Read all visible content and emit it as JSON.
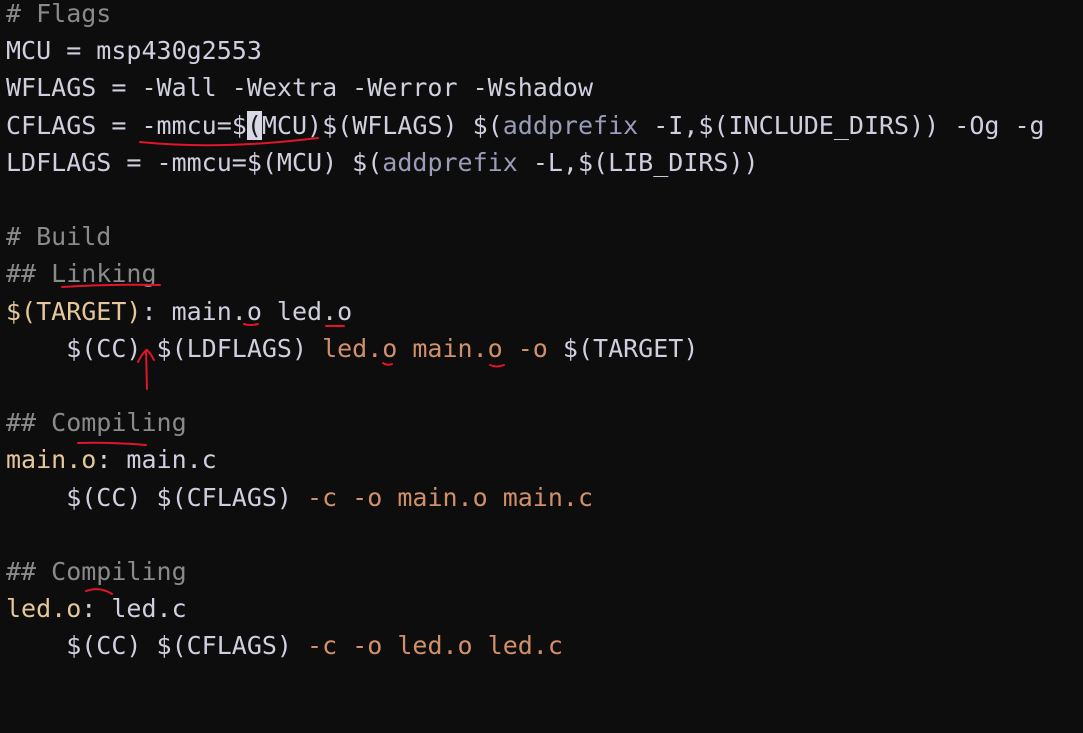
{
  "editor": {
    "lines": [
      {
        "segments": [
          {
            "text": "# Flags",
            "style": "cmt"
          }
        ]
      },
      {
        "segments": [
          {
            "text": "MCU = msp430g2553",
            "style": "vr"
          }
        ]
      },
      {
        "segments": [
          {
            "text": "WFLAGS = -Wall -Wextra -Werror -Wshadow",
            "style": "vr"
          }
        ]
      },
      {
        "segments": [
          {
            "text": "CFLAGS = -mmcu=$",
            "style": "vr"
          },
          {
            "text": "(",
            "style": "cur"
          },
          {
            "text": "MCU)$(WFLAGS) $(",
            "style": "vr"
          },
          {
            "text": "addprefix",
            "style": "fn"
          },
          {
            "text": " -I,$(INCLUDE_DIRS)) -Og -g",
            "style": "vr"
          }
        ]
      },
      {
        "segments": [
          {
            "text": "LDFLAGS = -mmcu=$(MCU) $(",
            "style": "vr"
          },
          {
            "text": "addprefix",
            "style": "fn"
          },
          {
            "text": " -L,$(LIB_DIRS))",
            "style": "vr"
          }
        ]
      },
      {
        "segments": []
      },
      {
        "segments": [
          {
            "text": "# Build",
            "style": "cmt"
          }
        ]
      },
      {
        "segments": [
          {
            "text": "## Linking",
            "style": "cmt"
          }
        ]
      },
      {
        "segments": [
          {
            "text": "$(TARGET)",
            "style": "tgt"
          },
          {
            "text": ": main.o led.o",
            "style": "vr"
          }
        ]
      },
      {
        "segments": [
          {
            "text": "    $(CC) $(LDFLAGS) ",
            "style": "vr"
          },
          {
            "text": "led.o main.o -o",
            "style": "fl"
          },
          {
            "text": " $(TARGET)",
            "style": "vr"
          }
        ]
      },
      {
        "segments": []
      },
      {
        "segments": [
          {
            "text": "## Compiling",
            "style": "cmt"
          }
        ]
      },
      {
        "segments": [
          {
            "text": "main.o",
            "style": "tgt"
          },
          {
            "text": ": main.c",
            "style": "vr"
          }
        ]
      },
      {
        "segments": [
          {
            "text": "    $(CC) $(CFLAGS) ",
            "style": "vr"
          },
          {
            "text": "-c -o main.o main.c",
            "style": "fl"
          }
        ]
      },
      {
        "segments": []
      },
      {
        "segments": [
          {
            "text": "## Compiling",
            "style": "cmt"
          }
        ]
      },
      {
        "segments": [
          {
            "text": "led.o",
            "style": "tgt"
          },
          {
            "text": ": led.c",
            "style": "vr"
          }
        ]
      },
      {
        "segments": [
          {
            "text": "    $(CC) $(CFLAGS) ",
            "style": "vr"
          },
          {
            "text": "-c -o led.o led.c",
            "style": "fl"
          }
        ]
      }
    ]
  },
  "colors": {
    "background": "#0d0d0d",
    "annotation_ink": "#e0142a"
  }
}
